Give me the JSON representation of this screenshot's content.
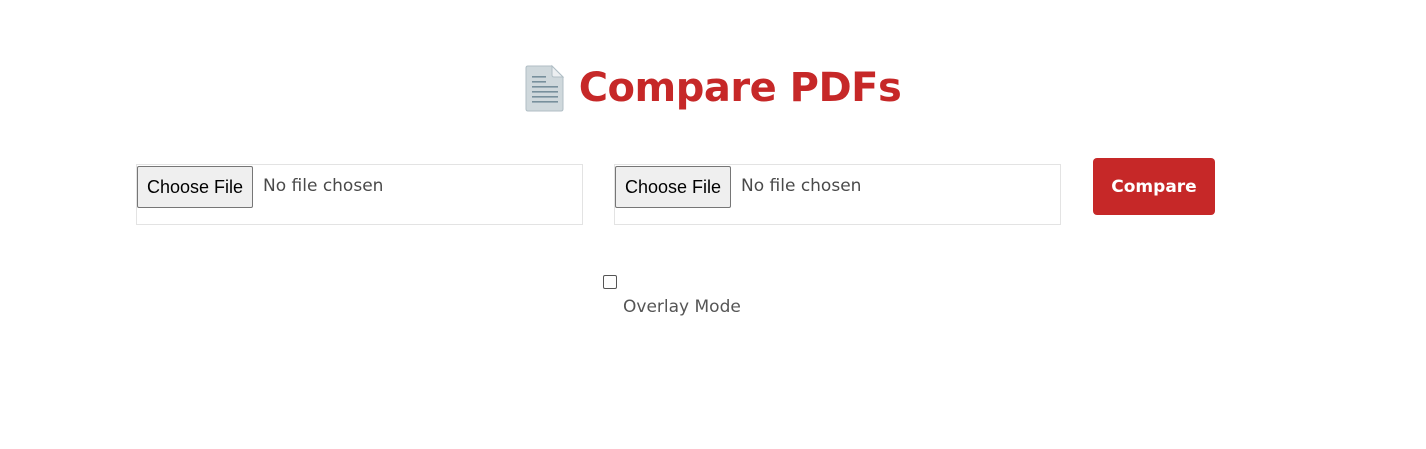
{
  "header": {
    "icon": "document-icon",
    "title": "Compare PDFs"
  },
  "file_inputs": [
    {
      "button_label": "Choose File",
      "status": "No file chosen"
    },
    {
      "button_label": "Choose File",
      "status": "No file chosen"
    }
  ],
  "compare_button": {
    "label": "Compare"
  },
  "overlay": {
    "label": "Overlay Mode",
    "checked": false
  },
  "colors": {
    "accent": "#c62828",
    "icon": "#b0bec5",
    "text_muted": "#555555"
  }
}
